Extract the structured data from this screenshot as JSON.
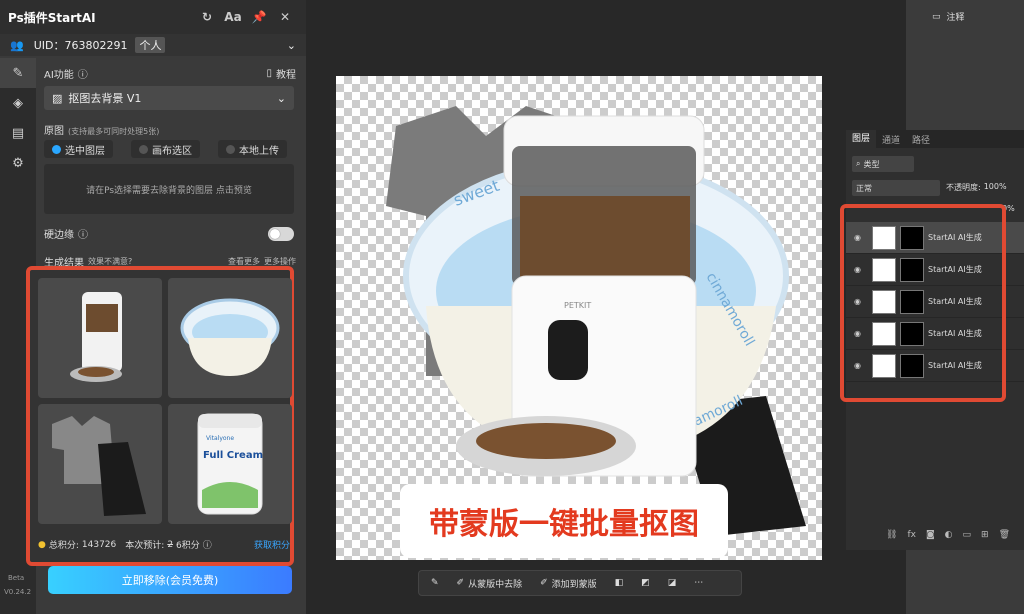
{
  "plugin": {
    "title": "Ps插件StartAI",
    "title_buttons": [
      "↻",
      "Aa",
      "📌",
      "✕"
    ],
    "uid_label": "UID：",
    "uid_value": "763802291",
    "account_type": "个人",
    "ai_function_label": "AI功能",
    "tutorial_label": "教程",
    "function_selected": "抠图去背景 V1",
    "source_label": "原图",
    "source_hint": "(支持最多可同时处理5张)",
    "source_options": [
      "选中图层",
      "画布选区",
      "本地上传"
    ],
    "source_selected_index": 0,
    "placeholder": "请在Ps选择需要去除背景的图层 点击预览",
    "hard_edge_label": "硬边缘",
    "results_label": "生成结果",
    "results_feedback": "效果不满意?",
    "view_more": "查看更多",
    "more_ops": "更多操作",
    "total_points_label": "总积分:",
    "total_points": "143726",
    "estimate_label": "本次预计:",
    "estimate_old": "2",
    "estimate_new": "6积分",
    "get_points": "获取积分",
    "cta_label": "立即移除(会员免费)",
    "beta_label": "Beta",
    "version": "V0.24.2"
  },
  "canvas_banner": "带蒙版一键批量抠图",
  "canvas_product_brand": "PETKIT",
  "bowl_text_1": "sweet",
  "bowl_text_2": "cinnamoroll",
  "bowl_text_3": "amoroll",
  "bottom_bar": {
    "remove_from_mask": "从蒙版中去除",
    "add_to_mask": "添加到蒙版"
  },
  "right_panel": {
    "notes_label": "注释",
    "tabs": [
      "图层",
      "通道",
      "路径"
    ],
    "kind_filter": "类型",
    "blend_mode": "正常",
    "opacity_label": "不透明度:",
    "opacity_value": "100%",
    "fill_value": "0%",
    "layers": [
      "StartAI AI生成",
      "StartAI AI生成",
      "StartAI AI生成",
      "StartAI AI生成",
      "StartAI AI生成"
    ]
  },
  "thumb_labels": {
    "milk_brand": "Full Cream",
    "milk_sub": "Vitalyone"
  },
  "colors": {
    "accent": "#e04a33",
    "cta_start": "#38d0ff",
    "cta_end": "#3b7bff",
    "banner_text": "#e33a1f"
  }
}
